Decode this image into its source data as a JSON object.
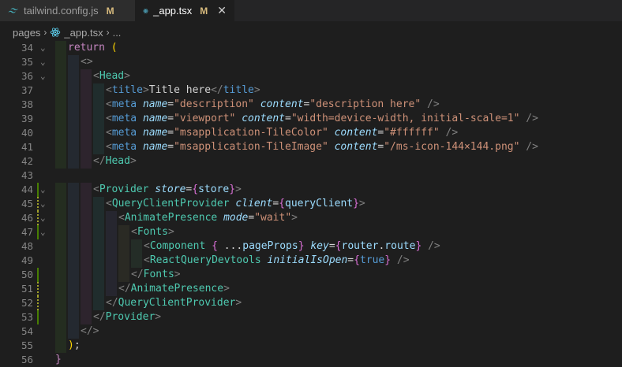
{
  "tabs": [
    {
      "label": "tailwind.config.js",
      "status": "M",
      "active": false,
      "icon": "tailwind-icon"
    },
    {
      "label": "_app.tsx",
      "status": "M",
      "active": true,
      "icon": "react-icon"
    }
  ],
  "breadcrumb": {
    "folder": "pages",
    "file": "_app.tsx",
    "more": "..."
  },
  "editor": {
    "lines": [
      {
        "n": "34",
        "fold": "v",
        "gutter": "",
        "indent": 1,
        "tokens": [
          [
            "c-kw",
            "return"
          ],
          [
            "c-punct",
            " "
          ],
          [
            "c-gold",
            "("
          ]
        ]
      },
      {
        "n": "35",
        "fold": "v",
        "gutter": "",
        "indent": 2,
        "tokens": [
          [
            "c-tagbr",
            "<>"
          ]
        ]
      },
      {
        "n": "36",
        "fold": "v",
        "gutter": "",
        "indent": 3,
        "tokens": [
          [
            "c-tagbr",
            "<"
          ],
          [
            "c-comp",
            "Head"
          ],
          [
            "c-tagbr",
            ">"
          ]
        ]
      },
      {
        "n": "37",
        "fold": "",
        "gutter": "",
        "indent": 4,
        "tokens": [
          [
            "c-tagbr",
            "<"
          ],
          [
            "c-tag",
            "title"
          ],
          [
            "c-tagbr",
            ">"
          ],
          [
            "c-text",
            "Title here"
          ],
          [
            "c-tagbr",
            "</"
          ],
          [
            "c-tag",
            "title"
          ],
          [
            "c-tagbr",
            ">"
          ]
        ]
      },
      {
        "n": "38",
        "fold": "",
        "gutter": "",
        "indent": 4,
        "tokens": [
          [
            "c-tagbr",
            "<"
          ],
          [
            "c-tag",
            "meta"
          ],
          [
            "c-text",
            " "
          ],
          [
            "c-attr",
            "name"
          ],
          [
            "c-punct",
            "="
          ],
          [
            "c-str",
            "\"description\""
          ],
          [
            "c-text",
            " "
          ],
          [
            "c-attr",
            "content"
          ],
          [
            "c-punct",
            "="
          ],
          [
            "c-str",
            "\"description here\""
          ],
          [
            "c-text",
            " "
          ],
          [
            "c-tagbr",
            "/>"
          ]
        ]
      },
      {
        "n": "39",
        "fold": "",
        "gutter": "",
        "indent": 4,
        "tokens": [
          [
            "c-tagbr",
            "<"
          ],
          [
            "c-tag",
            "meta"
          ],
          [
            "c-text",
            " "
          ],
          [
            "c-attr",
            "name"
          ],
          [
            "c-punct",
            "="
          ],
          [
            "c-str",
            "\"viewport\""
          ],
          [
            "c-text",
            " "
          ],
          [
            "c-attr",
            "content"
          ],
          [
            "c-punct",
            "="
          ],
          [
            "c-str",
            "\"width=device-width, initial-scale=1\""
          ],
          [
            "c-text",
            " "
          ],
          [
            "c-tagbr",
            "/>"
          ]
        ]
      },
      {
        "n": "40",
        "fold": "",
        "gutter": "",
        "indent": 4,
        "tokens": [
          [
            "c-tagbr",
            "<"
          ],
          [
            "c-tag",
            "meta"
          ],
          [
            "c-text",
            " "
          ],
          [
            "c-attr",
            "name"
          ],
          [
            "c-punct",
            "="
          ],
          [
            "c-str",
            "\"msapplication-TileColor\""
          ],
          [
            "c-text",
            " "
          ],
          [
            "c-attr",
            "content"
          ],
          [
            "c-punct",
            "="
          ],
          [
            "c-str",
            "\"#ffffff\""
          ],
          [
            "c-text",
            " "
          ],
          [
            "c-tagbr",
            "/>"
          ]
        ]
      },
      {
        "n": "41",
        "fold": "",
        "gutter": "",
        "indent": 4,
        "tokens": [
          [
            "c-tagbr",
            "<"
          ],
          [
            "c-tag",
            "meta"
          ],
          [
            "c-text",
            " "
          ],
          [
            "c-attr",
            "name"
          ],
          [
            "c-punct",
            "="
          ],
          [
            "c-str",
            "\"msapplication-TileImage\""
          ],
          [
            "c-text",
            " "
          ],
          [
            "c-attr",
            "content"
          ],
          [
            "c-punct",
            "="
          ],
          [
            "c-str",
            "\"/ms-icon-144×144.png\""
          ],
          [
            "c-text",
            " "
          ],
          [
            "c-tagbr",
            "/>"
          ]
        ]
      },
      {
        "n": "42",
        "fold": "",
        "gutter": "",
        "indent": 3,
        "tokens": [
          [
            "c-tagbr",
            "</"
          ],
          [
            "c-comp",
            "Head"
          ],
          [
            "c-tagbr",
            ">"
          ]
        ]
      },
      {
        "n": "43",
        "fold": "",
        "gutter": "",
        "indent": 0,
        "tokens": []
      },
      {
        "n": "44",
        "fold": "v",
        "gutter": "add",
        "indent": 3,
        "tokens": [
          [
            "c-tagbr",
            "<"
          ],
          [
            "c-comp",
            "Provider"
          ],
          [
            "c-text",
            " "
          ],
          [
            "c-attr",
            "store"
          ],
          [
            "c-punct",
            "="
          ],
          [
            "c-brace",
            "{"
          ],
          [
            "c-var",
            "store"
          ],
          [
            "c-brace",
            "}"
          ],
          [
            "c-tagbr",
            ">"
          ]
        ]
      },
      {
        "n": "45",
        "fold": "v",
        "gutter": "strip",
        "indent": 4,
        "tokens": [
          [
            "c-tagbr",
            "<"
          ],
          [
            "c-comp",
            "QueryClientProvider"
          ],
          [
            "c-text",
            " "
          ],
          [
            "c-attr",
            "client"
          ],
          [
            "c-punct",
            "="
          ],
          [
            "c-brace",
            "{"
          ],
          [
            "c-var",
            "queryClient"
          ],
          [
            "c-brace",
            "}"
          ],
          [
            "c-tagbr",
            ">"
          ]
        ]
      },
      {
        "n": "46",
        "fold": "v",
        "gutter": "strip",
        "indent": 5,
        "tokens": [
          [
            "c-tagbr",
            "<"
          ],
          [
            "c-comp",
            "AnimatePresence"
          ],
          [
            "c-text",
            " "
          ],
          [
            "c-attr",
            "mode"
          ],
          [
            "c-punct",
            "="
          ],
          [
            "c-str",
            "\"wait\""
          ],
          [
            "c-tagbr",
            ">"
          ]
        ]
      },
      {
        "n": "47",
        "fold": "v",
        "gutter": "add",
        "indent": 6,
        "tokens": [
          [
            "c-tagbr",
            "<"
          ],
          [
            "c-comp",
            "Fonts"
          ],
          [
            "c-tagbr",
            ">"
          ]
        ]
      },
      {
        "n": "48",
        "fold": "",
        "gutter": "",
        "indent": 7,
        "tokens": [
          [
            "c-tagbr",
            "<"
          ],
          [
            "c-comp",
            "Component"
          ],
          [
            "c-text",
            " "
          ],
          [
            "c-brace",
            "{"
          ],
          [
            "c-text",
            " ..."
          ],
          [
            "c-var",
            "pageProps"
          ],
          [
            "c-brace",
            "}"
          ],
          [
            "c-text",
            " "
          ],
          [
            "c-attr",
            "key"
          ],
          [
            "c-punct",
            "="
          ],
          [
            "c-brace",
            "{"
          ],
          [
            "c-var",
            "router"
          ],
          [
            "c-text",
            "."
          ],
          [
            "c-var",
            "route"
          ],
          [
            "c-brace",
            "}"
          ],
          [
            "c-text",
            " "
          ],
          [
            "c-tagbr",
            "/>"
          ]
        ]
      },
      {
        "n": "49",
        "fold": "",
        "gutter": "",
        "indent": 7,
        "tokens": [
          [
            "c-tagbr",
            "<"
          ],
          [
            "c-comp",
            "ReactQueryDevtools"
          ],
          [
            "c-text",
            " "
          ],
          [
            "c-attr",
            "initialIsOpen"
          ],
          [
            "c-punct",
            "="
          ],
          [
            "c-brace",
            "{"
          ],
          [
            "c-true",
            "true"
          ],
          [
            "c-brace",
            "}"
          ],
          [
            "c-text",
            " "
          ],
          [
            "c-tagbr",
            "/>"
          ]
        ]
      },
      {
        "n": "50",
        "fold": "",
        "gutter": "add",
        "indent": 6,
        "tokens": [
          [
            "c-tagbr",
            "</"
          ],
          [
            "c-comp",
            "Fonts"
          ],
          [
            "c-tagbr",
            ">"
          ]
        ]
      },
      {
        "n": "51",
        "fold": "",
        "gutter": "strip",
        "indent": 5,
        "tokens": [
          [
            "c-tagbr",
            "</"
          ],
          [
            "c-comp",
            "AnimatePresence"
          ],
          [
            "c-tagbr",
            ">"
          ]
        ]
      },
      {
        "n": "52",
        "fold": "",
        "gutter": "strip",
        "indent": 4,
        "tokens": [
          [
            "c-tagbr",
            "</"
          ],
          [
            "c-comp",
            "QueryClientProvider"
          ],
          [
            "c-tagbr",
            ">"
          ]
        ]
      },
      {
        "n": "53",
        "fold": "",
        "gutter": "add",
        "indent": 3,
        "tokens": [
          [
            "c-tagbr",
            "</"
          ],
          [
            "c-comp",
            "Provider"
          ],
          [
            "c-tagbr",
            ">"
          ]
        ]
      },
      {
        "n": "54",
        "fold": "",
        "gutter": "",
        "indent": 2,
        "tokens": [
          [
            "c-tagbr",
            "</>"
          ]
        ]
      },
      {
        "n": "55",
        "fold": "",
        "gutter": "",
        "indent": 1,
        "tokens": [
          [
            "c-gold",
            ")"
          ],
          [
            "c-punct",
            ";"
          ]
        ]
      },
      {
        "n": "56",
        "fold": "",
        "gutter": "",
        "indent": 0,
        "tokens": [
          [
            "c-kw",
            "}"
          ]
        ]
      }
    ]
  },
  "colors": {
    "background": "#1e1e1e",
    "tab_bar": "#252526",
    "modified": "#d7ba7d",
    "git_added": "#487e02"
  }
}
